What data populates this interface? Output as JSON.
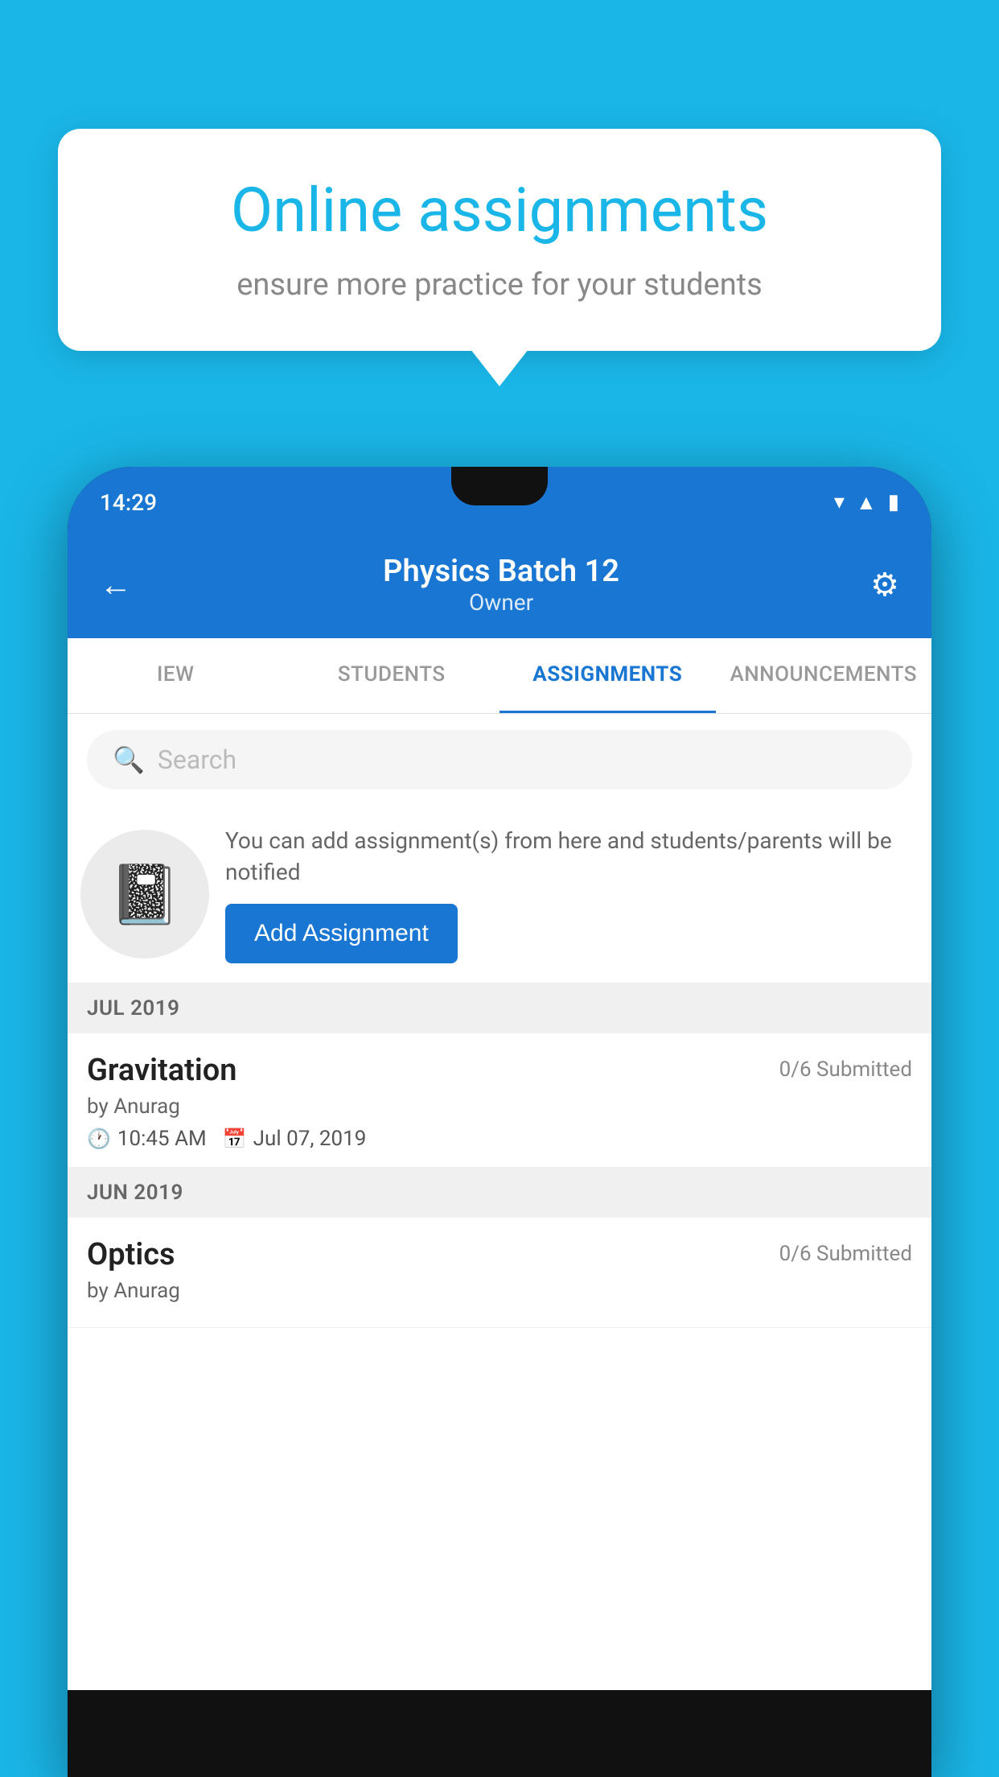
{
  "background_color": "#1ab6e8",
  "bubble": {
    "title": "Online assignments",
    "subtitle": "ensure more practice for your students"
  },
  "phone": {
    "status_bar": {
      "time": "14:29"
    },
    "header": {
      "title": "Physics Batch 12",
      "subtitle": "Owner",
      "back_label": "←",
      "settings_label": "⚙"
    },
    "tabs": [
      {
        "label": "IEW",
        "active": false
      },
      {
        "label": "STUDENTS",
        "active": false
      },
      {
        "label": "ASSIGNMENTS",
        "active": true
      },
      {
        "label": "ANNOUNCEMENTS",
        "active": false
      }
    ],
    "search": {
      "placeholder": "Search"
    },
    "promo": {
      "description": "You can add assignment(s) from here and students/parents will be notified",
      "button_label": "Add Assignment"
    },
    "sections": [
      {
        "label": "JUL 2019",
        "assignments": [
          {
            "title": "Gravitation",
            "submitted": "0/6 Submitted",
            "author": "by Anurag",
            "time": "10:45 AM",
            "date": "Jul 07, 2019"
          }
        ]
      },
      {
        "label": "JUN 2019",
        "assignments": [
          {
            "title": "Optics",
            "submitted": "0/6 Submitted",
            "author": "by Anurag",
            "time": "",
            "date": ""
          }
        ]
      }
    ]
  }
}
